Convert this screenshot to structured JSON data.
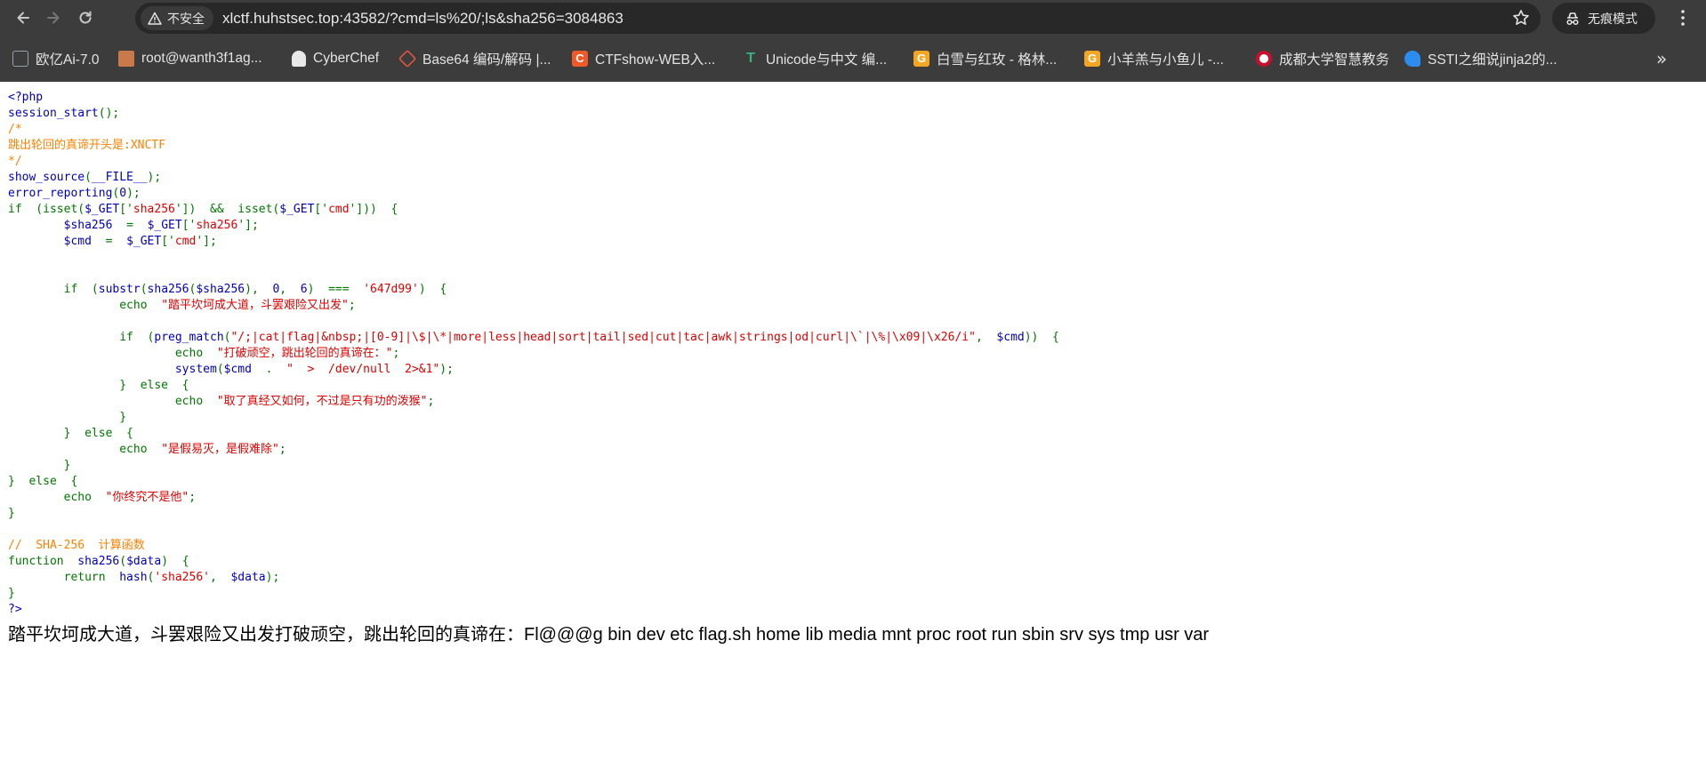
{
  "browser": {
    "security_label": "不安全",
    "url": "xlctf.huhstsec.top:43582/?cmd=ls%20/;ls&sha256=3084863",
    "incognito_label": "无痕模式",
    "icons": {
      "back": "back-arrow-icon",
      "forward": "forward-arrow-icon",
      "reload": "reload-icon",
      "security": "not-secure-icon",
      "bookmark_star": "star-icon",
      "incognito": "incognito-icon",
      "menu": "more-vert-icon"
    }
  },
  "bookmarks": [
    {
      "label": "欧亿Ai-7.0",
      "icon": "chat-icon",
      "color": "#9aa0a6"
    },
    {
      "label": "root@wanth3f1ag...",
      "icon": "avatar-icon",
      "color": "#c9794a"
    },
    {
      "label": "CyberChef",
      "icon": "chef-hat-icon",
      "color": "#e8e8e8"
    },
    {
      "label": "Base64 编码/解码 |...",
      "icon": "cube-icon",
      "color": "#e2553f"
    },
    {
      "label": "CTFshow-WEB入...",
      "icon": "c-logo-icon",
      "color": "#f05a28"
    },
    {
      "label": "Unicode与中文 编...",
      "icon": "t-logo-icon",
      "color": "#36b37e"
    },
    {
      "label": "白雪与红玫 - 格林...",
      "icon": "g-logo-icon",
      "color": "#f4a623"
    },
    {
      "label": "小羊羔与小鱼儿 -...",
      "icon": "g-logo-icon",
      "color": "#f4a623"
    },
    {
      "label": "成都大学智慧教务",
      "icon": "seal-icon",
      "color": "#c8102e"
    },
    {
      "label": "SSTI之细说jinja2的...",
      "icon": "wifi-shield-icon",
      "color": "#2d8cf0"
    }
  ],
  "bookmarks_overflow": "»",
  "colors": {
    "default": "#0000bb",
    "keyword": "#007700",
    "string": "#dd0000",
    "comment": "#ff8000"
  },
  "code_lines": [
    [
      [
        "d",
        "<?php"
      ]
    ],
    [
      [
        "d",
        "session_start"
      ],
      [
        "k",
        "();"
      ]
    ],
    [
      [
        "c",
        "/*"
      ]
    ],
    [
      [
        "c",
        "跳出轮回的真谛开头是:XNCTF"
      ]
    ],
    [
      [
        "c",
        "*/"
      ]
    ],
    [
      [
        "d",
        "show_source"
      ],
      [
        "k",
        "("
      ],
      [
        "d",
        "__FILE__"
      ],
      [
        "k",
        ");"
      ]
    ],
    [
      [
        "d",
        "error_reporting"
      ],
      [
        "k",
        "("
      ],
      [
        "d",
        "0"
      ],
      [
        "k",
        ");"
      ]
    ],
    [
      [
        "k",
        "if  (isset("
      ],
      [
        "d",
        "$_GET"
      ],
      [
        "k",
        "['"
      ],
      [
        "s",
        "sha256"
      ],
      [
        "k",
        "'])  &&  isset("
      ],
      [
        "d",
        "$_GET"
      ],
      [
        "k",
        "['"
      ],
      [
        "s",
        "cmd"
      ],
      [
        "k",
        "']))  {"
      ]
    ],
    [
      [
        "k",
        "        "
      ],
      [
        "d",
        "$sha256  "
      ],
      [
        "k",
        "=  "
      ],
      [
        "d",
        "$_GET"
      ],
      [
        "k",
        "['"
      ],
      [
        "s",
        "sha256"
      ],
      [
        "k",
        "'];"
      ]
    ],
    [
      [
        "k",
        "        "
      ],
      [
        "d",
        "$cmd  "
      ],
      [
        "k",
        "=  "
      ],
      [
        "d",
        "$_GET"
      ],
      [
        "k",
        "['"
      ],
      [
        "s",
        "cmd"
      ],
      [
        "k",
        "'];"
      ]
    ],
    [],
    [],
    [
      [
        "k",
        "        if  ("
      ],
      [
        "d",
        "substr"
      ],
      [
        "k",
        "("
      ],
      [
        "d",
        "sha256"
      ],
      [
        "k",
        "("
      ],
      [
        "d",
        "$sha256"
      ],
      [
        "k",
        "),  "
      ],
      [
        "d",
        "0"
      ],
      [
        "k",
        ",  "
      ],
      [
        "d",
        "6"
      ],
      [
        "k",
        ")  ===  "
      ],
      [
        "s",
        "'647d99'"
      ],
      [
        "k",
        ")  {"
      ]
    ],
    [
      [
        "k",
        "                echo  "
      ],
      [
        "s",
        "\"踏平坎坷成大道，斗罢艰险又出发\""
      ],
      [
        "k",
        ";"
      ]
    ],
    [],
    [
      [
        "k",
        "                if  ("
      ],
      [
        "d",
        "preg_match"
      ],
      [
        "k",
        "("
      ],
      [
        "s",
        "\"/;|cat|flag|&nbsp;|[0-9]|\\$|\\*|more|less|head|sort|tail|sed|cut|tac|awk|strings|od|curl|\\`|\\%|\\x09|\\x26/i\""
      ],
      [
        "k",
        ",  "
      ],
      [
        "d",
        "$cmd"
      ],
      [
        "k",
        "))  {"
      ]
    ],
    [
      [
        "k",
        "                        echo  "
      ],
      [
        "s",
        "\"打破顽空，跳出轮回的真谛在：\""
      ],
      [
        "k",
        ";"
      ]
    ],
    [
      [
        "k",
        "                        "
      ],
      [
        "d",
        "system"
      ],
      [
        "k",
        "("
      ],
      [
        "d",
        "$cmd  "
      ],
      [
        "k",
        ".  "
      ],
      [
        "s",
        "\"  >  /dev/null  2>&1\""
      ],
      [
        "k",
        ");"
      ]
    ],
    [
      [
        "k",
        "                }  else  {"
      ]
    ],
    [
      [
        "k",
        "                        echo  "
      ],
      [
        "s",
        "\"取了真经又如何，不过是只有功的泼猴\""
      ],
      [
        "k",
        ";"
      ]
    ],
    [
      [
        "k",
        "                }"
      ]
    ],
    [
      [
        "k",
        "        }  else  {"
      ]
    ],
    [
      [
        "k",
        "                echo  "
      ],
      [
        "s",
        "\"是假易灭，是假难除\""
      ],
      [
        "k",
        ";"
      ]
    ],
    [
      [
        "k",
        "        }"
      ]
    ],
    [
      [
        "k",
        "}  else  {"
      ]
    ],
    [
      [
        "k",
        "        echo  "
      ],
      [
        "s",
        "\"你终究不是他\""
      ],
      [
        "k",
        ";"
      ]
    ],
    [
      [
        "k",
        "}"
      ]
    ],
    [],
    [
      [
        "c",
        "//  SHA-256  计算函数"
      ]
    ],
    [
      [
        "k",
        "function  "
      ],
      [
        "d",
        "sha256"
      ],
      [
        "k",
        "("
      ],
      [
        "d",
        "$data"
      ],
      [
        "k",
        ")  {"
      ]
    ],
    [
      [
        "k",
        "        return  "
      ],
      [
        "d",
        "hash"
      ],
      [
        "k",
        "("
      ],
      [
        "s",
        "'sha256'"
      ],
      [
        "k",
        ",  "
      ],
      [
        "d",
        "$data"
      ],
      [
        "k",
        ");"
      ]
    ],
    [
      [
        "k",
        "}"
      ]
    ],
    [
      [
        "d",
        "?>"
      ]
    ]
  ],
  "output_text": "踏平坎坷成大道，斗罢艰险又出发打破顽空，跳出轮回的真谛在：Fl@@@g bin dev etc flag.sh home lib media mnt proc root run sbin srv sys tmp usr var"
}
